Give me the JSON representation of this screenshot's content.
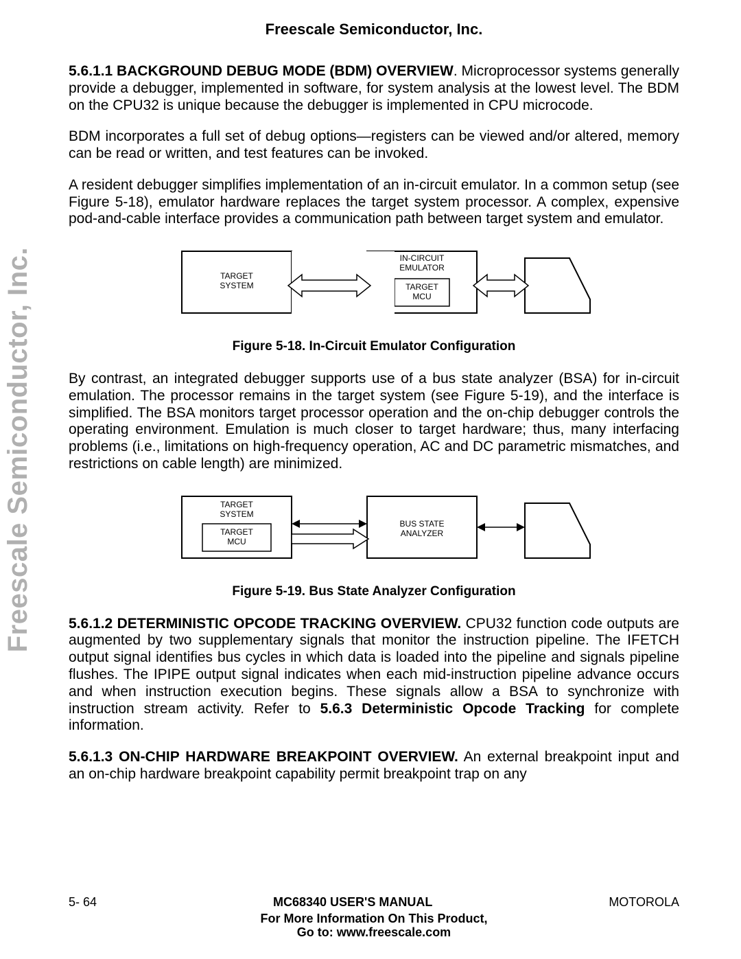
{
  "header": {
    "company": "Freescale Semiconductor, Inc."
  },
  "watermark": "Freescale Semiconductor, Inc.",
  "sections": {
    "s1_title": "5.6.1.1 BACKGROUND DEBUG MODE (BDM) OVERVIEW",
    "s1_p1_rest": ". Microprocessor systems generally provide a debugger, implemented in software, for system analysis at the lowest level. The BDM on the CPU32 is unique because the debugger is implemented in CPU microcode.",
    "s1_p2": "BDM incorporates a full set of debug options—registers can be viewed and/or altered, memory can be read or written, and test features can be invoked.",
    "s1_p3": "A resident debugger simplifies implementation of an in-circuit emulator. In a common setup (see Figure 5-18), emulator hardware replaces the target system processor. A complex, expensive pod-and-cable interface provides a communication path between target system and emulator.",
    "fig18_caption": "Figure 5-18. In-Circuit Emulator Configuration",
    "s1_p4": "By contrast, an integrated debugger supports use of a bus state analyzer (BSA) for in-circuit emulation. The processor remains in the target system (see Figure 5-19), and the interface is simplified. The BSA monitors target processor operation and the on-chip debugger controls the operating environment. Emulation is much closer to target hardware; thus, many interfacing problems (i.e., limitations on high-frequency operation, AC and DC parametric mismatches, and restrictions on cable length) are minimized.",
    "fig19_caption": "Figure 5-19. Bus State Analyzer Configuration",
    "s2_title": "5.6.1.2 DETERMINISTIC OPCODE TRACKING OVERVIEW.",
    "s2_p1_before": " CPU32 function code outputs are augmented by two supplementary signals that monitor the instruction pipeline. The IFETCH output signal identifies bus cycles in which data is loaded into the pipeline and signals pipeline flushes. The IPIPE output signal indicates when each mid-instruction pipeline advance occurs and when instruction execution begins. These signals allow a BSA to synchronize with instruction stream activity. Refer to ",
    "s2_xref": "5.6.3 Deterministic Opcode Tracking",
    "s2_p1_after": " for complete information.",
    "s3_title": "5.6.1.3 ON-CHIP HARDWARE BREAKPOINT OVERVIEW.",
    "s3_p1": " An external breakpoint input and an on-chip hardware breakpoint capability permit breakpoint trap on any"
  },
  "fig18": {
    "target_system": "TARGET\nSYSTEM",
    "in_circuit": "IN-CIRCUIT\nEMULATOR",
    "target_mcu": "TARGET\nMCU"
  },
  "fig19": {
    "target_system": "TARGET\nSYSTEM",
    "target_mcu": "TARGET\nMCU",
    "bsa": "BUS STATE\nANALYZER"
  },
  "footer": {
    "page": "5- 64",
    "manual": "MC68340 USER'S MANUAL",
    "brand": "MOTOROLA",
    "info1": "For More Information On This Product,",
    "info2": "Go to: www.freescale.com"
  }
}
